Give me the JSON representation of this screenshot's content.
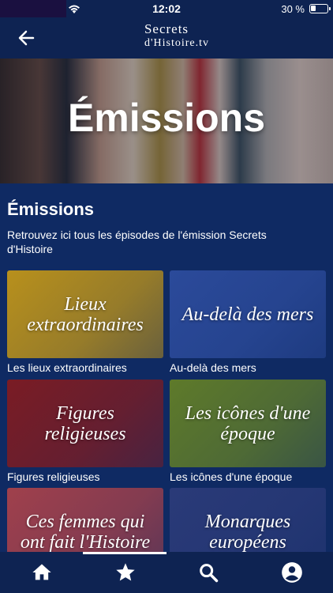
{
  "status": {
    "time": "12:02",
    "battery": "30 %",
    "battery_level": 0.3
  },
  "header": {
    "logo_line1": "Secrets",
    "logo_line2": "d'Histoire.tv"
  },
  "hero": {
    "title": "Émissions"
  },
  "section": {
    "title": "Émissions",
    "description": "Retrouvez ici tous les épisodes de l'émission Secrets d'Histoire"
  },
  "cards": [
    {
      "overlay": "Lieux extraordinaires",
      "label": "Les lieux extraordinaires",
      "color": "#b8901c"
    },
    {
      "overlay": "Au-delà des mers",
      "label": "Au-delà des mers",
      "color": "#2b4a9a"
    },
    {
      "overlay": "Figures religieuses",
      "label": "Figures religieuses",
      "color": "#7a1c24"
    },
    {
      "overlay": "Les icônes d'une époque",
      "label": "Les icônes d'une époque",
      "color": "#5e7a2a"
    },
    {
      "overlay": "Ces femmes qui ont fait l'Histoire",
      "label": "",
      "color": "#a0404c"
    },
    {
      "overlay": "Monarques européens",
      "label": "",
      "color": "#2a3a78"
    }
  ],
  "nav": {
    "items": [
      "home-icon",
      "star-icon",
      "search-icon",
      "account-icon"
    ],
    "active": 1
  }
}
